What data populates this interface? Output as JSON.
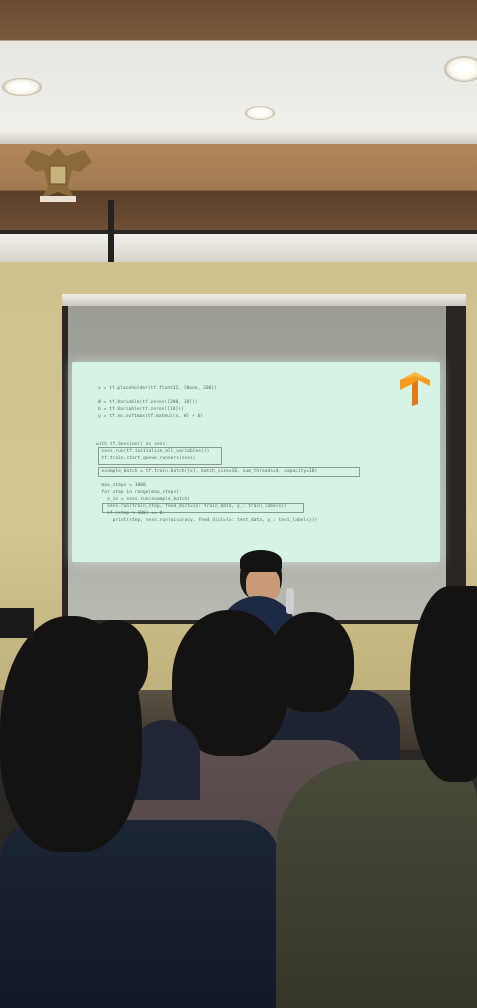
{
  "scene": {
    "description_free": true,
    "colors": {
      "slide_bg": "#d5f4e6",
      "wall": "#cfc28d",
      "ceiling_wood": "#7a5a3d",
      "logo_orange": "#f49c20"
    }
  },
  "slide": {
    "logo_icon": "tensorflow-logo-icon",
    "code_lines": [
      "x = tf.placeholder(tf.float32, [None, 200])",
      "",
      "W = tf.Variable(tf.zeros([200, 10]))",
      "b = tf.Variable(tf.zeros([10]))",
      "y = tf.nn.softmax(tf.matmul(x, W) + b)",
      "",
      "",
      "",
      "with tf.Session() as sess:",
      "  sess.run(tf.initialize_all_variables())",
      "  tf.train.start_queue_runners(sess)",
      "",
      "  example_batch = tf.train.batch([x], batch_size=10, num_threads=4, capacity=10)",
      "",
      "  max_steps = 1000",
      "  for step in range(max_steps):",
      "    x_in = sess.run(example_batch)",
      "    sess.run(train_step, feed_dict={x: train_data, y_: train_labels})",
      "    if (step % 100) == 0:",
      "      print(step, sess.run(accuracy, feed_dict={x: test_data, y_: test_labels}))"
    ]
  }
}
